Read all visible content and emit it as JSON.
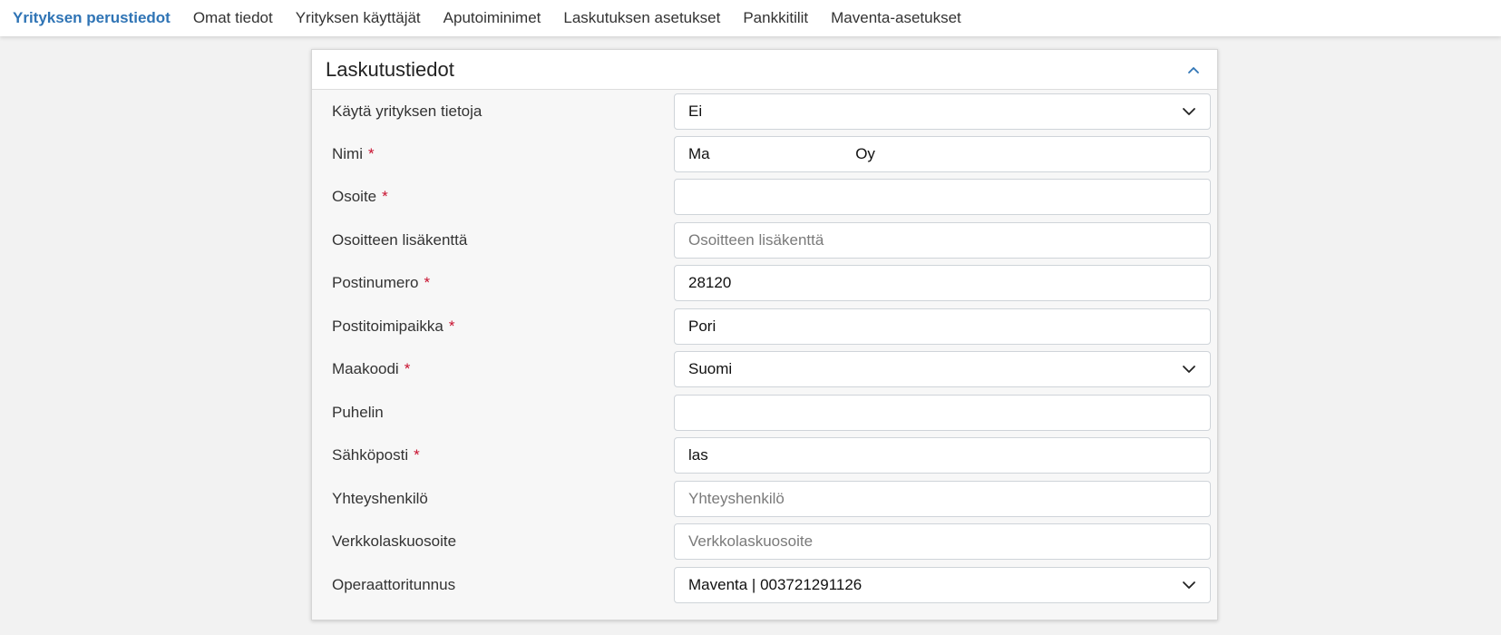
{
  "nav": {
    "tabs": [
      {
        "label": "Yrityksen perustiedot",
        "active": true
      },
      {
        "label": "Omat tiedot"
      },
      {
        "label": "Yrityksen käyttäjät"
      },
      {
        "label": "Aputoiminimet"
      },
      {
        "label": "Laskutuksen asetukset"
      },
      {
        "label": "Pankkitilit"
      },
      {
        "label": "Maventa-asetukset"
      }
    ]
  },
  "panel": {
    "title": "Laskutustiedot",
    "collapse_icon": "chevron-up-icon",
    "fields": {
      "use_company": {
        "label": "Käytä yrityksen tietoja",
        "value": "Ei",
        "type": "select"
      },
      "name": {
        "label": "Nimi",
        "required": "*",
        "value": "Ma                                  Oy"
      },
      "address": {
        "label": "Osoite",
        "required": "*",
        "value": ""
      },
      "address_extra": {
        "label": "Osoitteen lisäkenttä",
        "value": "",
        "placeholder": "Osoitteen lisäkenttä"
      },
      "postal_code": {
        "label": "Postinumero",
        "required": "*",
        "value": "28120"
      },
      "city": {
        "label": "Postitoimipaikka",
        "required": "*",
        "value": "Pori"
      },
      "country": {
        "label": "Maakoodi",
        "required": "*",
        "value": "Suomi",
        "type": "select"
      },
      "phone": {
        "label": "Puhelin",
        "value": ""
      },
      "email": {
        "label": "Sähköposti",
        "required": "*",
        "value": "las"
      },
      "contact": {
        "label": "Yhteyshenkilö",
        "value": "",
        "placeholder": "Yhteyshenkilö"
      },
      "einvoice": {
        "label": "Verkkolaskuosoite",
        "value": "",
        "placeholder": "Verkkolaskuosoite"
      },
      "operator": {
        "label": "Operaattoritunnus",
        "value": "Maventa | 003721291126",
        "type": "select"
      }
    }
  },
  "colors": {
    "accent": "#2f74b5",
    "required": "#c8102e",
    "background": "#f2f2f2"
  }
}
